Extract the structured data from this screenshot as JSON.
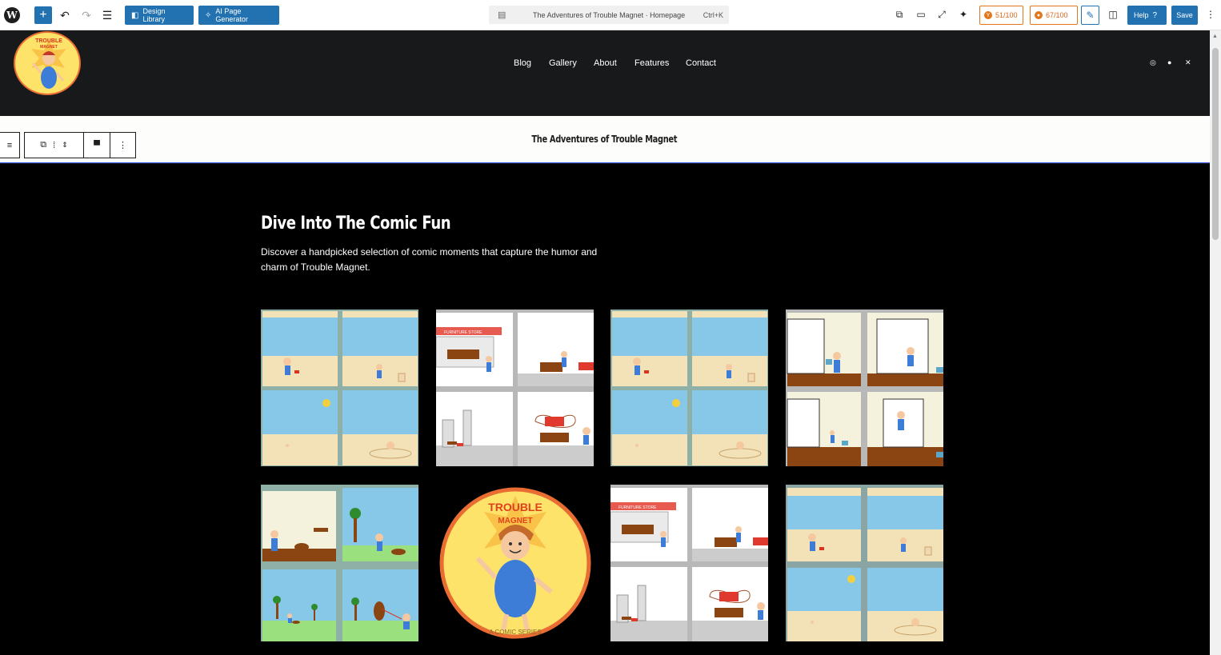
{
  "editor": {
    "toolbar": {
      "design_library": "Design Library",
      "ai_generator": "AI Page Generator",
      "command_title": "The Adventures of Trouble Magnet · Homepage",
      "command_shortcut": "Ctrl+K",
      "score_seo": "51/100",
      "score_readability": "67/100",
      "help": "Help",
      "save": "Save"
    }
  },
  "site": {
    "logo_text_top": "TROUBLE",
    "logo_text_bottom": "MAGNET",
    "nav": [
      "Blog",
      "Gallery",
      "About",
      "Features",
      "Contact"
    ],
    "title": "The Adventures of Trouble Magnet"
  },
  "content": {
    "heading": "Dive Into The Comic Fun",
    "intro": "Discover a handpicked selection of comic moments that capture the humor and charm of Trouble Magnet.",
    "badge_top": "TROUBLE",
    "badge_bottom": "MAGNET",
    "badge_caption": "A COMIC SERIES",
    "store_sign": "FURNITURE STORE"
  },
  "colors": {
    "accent": "#2271b1",
    "score": "#e2761b",
    "sky": "#87c8e8",
    "sand": "#f3e2b8",
    "grass": "#9be07e",
    "floor": "#8b4513",
    "badge": "#fde36a"
  },
  "icons": [
    "wordpress-logo-icon",
    "plus-icon",
    "undo-icon",
    "redo-icon",
    "list-view-icon",
    "instagram-icon",
    "facebook-icon",
    "x-icon"
  ]
}
